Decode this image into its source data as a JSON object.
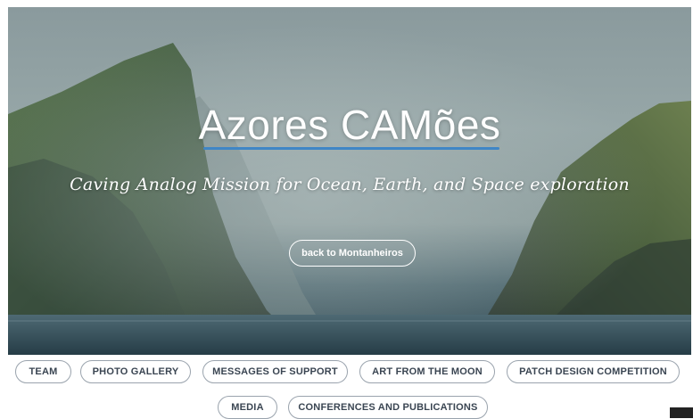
{
  "hero": {
    "title": "Azores CAMões",
    "subtitle": "Caving Analog Mission for Ocean, Earth, and Space exploration",
    "back_button": "back to Montanheiros"
  },
  "nav": {
    "items": [
      {
        "label": "TEAM"
      },
      {
        "label": "PHOTO GALLERY"
      },
      {
        "label": "MESSAGES OF SUPPORT"
      },
      {
        "label": "ART FROM THE MOON"
      },
      {
        "label": "PATCH DESIGN COMPETITION"
      },
      {
        "label": "MEDIA"
      },
      {
        "label": "CONFERENCES AND PUBLICATIONS"
      }
    ]
  },
  "colors": {
    "accent_underline": "#3f86c6",
    "pill_border": "#9aa3ad",
    "pill_text": "#3a4552"
  }
}
